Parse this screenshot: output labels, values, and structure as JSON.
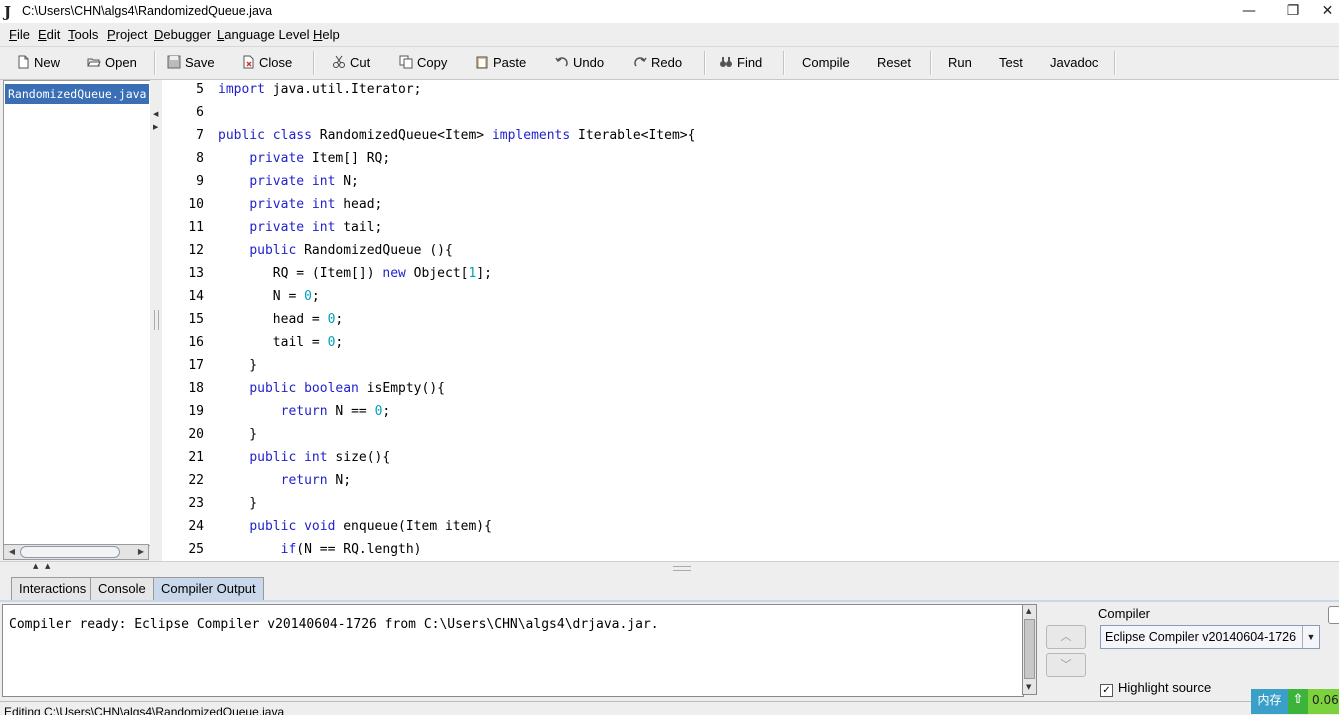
{
  "window": {
    "title": "C:\\Users\\CHN\\algs4\\RandomizedQueue.java",
    "minimize": "—",
    "maximize": "❐",
    "close": "✕"
  },
  "menu": [
    "File",
    "Edit",
    "Tools",
    "Project",
    "Debugger",
    "Language Level",
    "Help"
  ],
  "toolbar": {
    "new": "New",
    "open": "Open",
    "save": "Save",
    "close": "Close",
    "cut": "Cut",
    "copy": "Copy",
    "paste": "Paste",
    "undo": "Undo",
    "redo": "Redo",
    "find": "Find",
    "compile": "Compile",
    "reset": "Reset",
    "run": "Run",
    "test": "Test",
    "javadoc": "Javadoc"
  },
  "files": [
    "RandomizedQueue.java"
  ],
  "code": {
    "line_numbers": [
      "5",
      "6",
      "7",
      "8",
      "9",
      "10",
      "11",
      "12",
      "13",
      "14",
      "15",
      "16",
      "17",
      "18",
      "19",
      "20",
      "21",
      "22",
      "23",
      "24",
      "25"
    ]
  },
  "tabs": [
    "Interactions",
    "Console",
    "Compiler Output"
  ],
  "active_tab": "Compiler Output",
  "output": {
    "text": "Compiler ready: Eclipse Compiler v20140604-1726 from C:\\Users\\CHN\\algs4\\drjava.jar."
  },
  "compiler": {
    "label": "Compiler",
    "selected": "Eclipse Compiler v20140604-1726",
    "highlight_source": "Highlight source",
    "checkmark": "✓"
  },
  "status": {
    "editing": "Editing C:\\Users\\CHN\\algs4\\RandomizedQueue.java"
  },
  "memory_widget": {
    "label": "内存",
    "arrow": "⇧",
    "value": "0.06"
  },
  "colors": {
    "keyword": "#2222cc",
    "number": "#00a0b8",
    "selection": "#3b6fb5",
    "active_tab": "#c8d8ea"
  }
}
